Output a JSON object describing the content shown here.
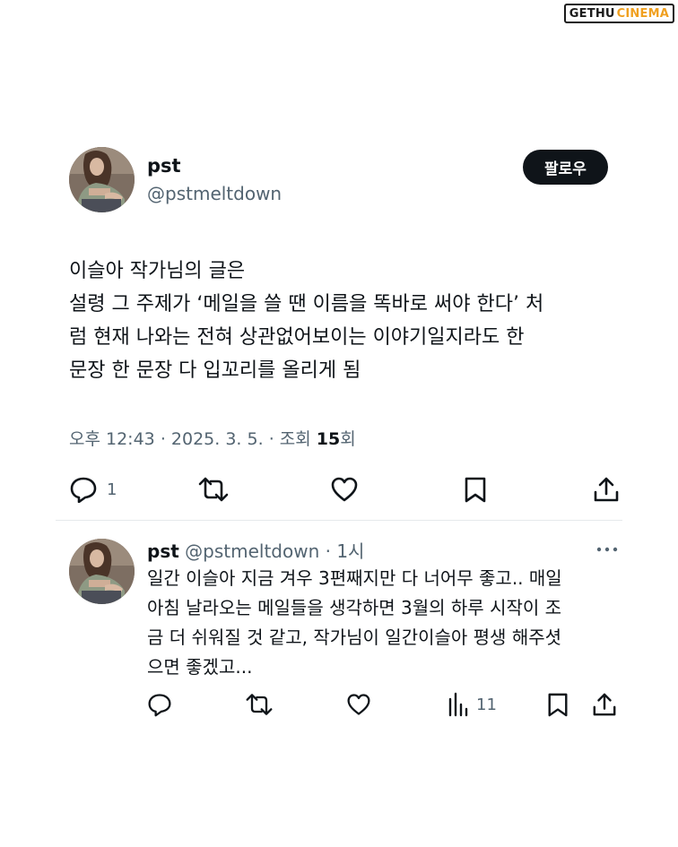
{
  "watermark": {
    "part1": "GETHU",
    "part2": "CINEMA"
  },
  "main_tweet": {
    "name": "pst",
    "handle": "@pstmeltdown",
    "follow_label": "팔로우",
    "text_lines": [
      "이슬아 작가님의 글은",
      "설령 그 주제가 ‘메일을 쓸 땐 이름을 똑바로 써야 한다’ 처",
      "럼 현재 나와는 전혀 상관없어보이는 이야기일지라도 한",
      "문장 한 문장 다 입꼬리를 올리게 됨"
    ],
    "time": "오후 12:43",
    "date": "2025. 3. 5.",
    "views_label": "조회",
    "views_count": "15",
    "views_suffix": "회",
    "reply_count": "1",
    "icons": [
      "reply-icon",
      "retweet-icon",
      "like-icon",
      "bookmark-icon",
      "share-icon"
    ]
  },
  "reply": {
    "name": "pst",
    "handle": "@pstmeltdown",
    "age": "1시",
    "text_lines": [
      "일간 이슬아 지금 겨우 3편째지만 다 너어무 좋고.. 매일",
      "아침 날라오는 메일들을 생각하면 3월의 하루 시작이 조",
      "금 더 쉬워질 것 같고, 작가님이 일간이슬아 평생 해주셧",
      "으면 좋겠고..."
    ],
    "views_count": "11",
    "icons": [
      "reply-icon",
      "retweet-icon",
      "like-icon",
      "views-icon",
      "bookmark-icon",
      "share-icon",
      "more-icon"
    ]
  },
  "colors": {
    "text": "#0f1419",
    "secondary": "#536471",
    "button_bg": "#0f1419",
    "divider": "#e6e9ec"
  }
}
